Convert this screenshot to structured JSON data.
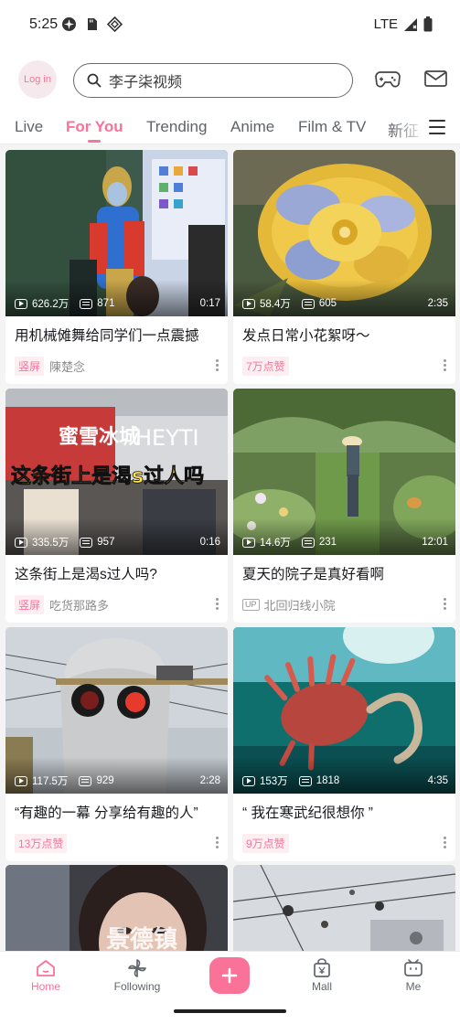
{
  "status": {
    "time": "5:25",
    "network": "LTE"
  },
  "header": {
    "login_label": "Log in",
    "search_text": "李子柒视频"
  },
  "tabs": [
    "Live",
    "For You",
    "Trending",
    "Anime",
    "Film & TV",
    "新征"
  ],
  "cards": [
    {
      "views": "626.2万",
      "danmaku": "871",
      "duration": "0:17",
      "title": "用机械傩舞给同学们一点震撼",
      "tag": "竖屏",
      "author": "陳楚念"
    },
    {
      "views": "58.4万",
      "danmaku": "605",
      "duration": "2:35",
      "title": "发点日常小花絮呀～",
      "tag": "7万点赞",
      "author": ""
    },
    {
      "views": "335.5万",
      "danmaku": "957",
      "duration": "0:16",
      "title": "这条街上是渴s过人吗?",
      "tag": "竖屏",
      "author": "吃货那路多",
      "overlay": "这条街上是渴s过人吗",
      "sign": "蜜雪冰城",
      "sign2": "HEYTI"
    },
    {
      "views": "14.6万",
      "danmaku": "231",
      "duration": "12:01",
      "title": "夏天的院子是真好看啊",
      "tag": "",
      "author": "北回归线小院",
      "badge": "UP"
    },
    {
      "views": "117.5万",
      "danmaku": "929",
      "duration": "2:28",
      "title": "“有趣的一幕 分享给有趣的人”",
      "tag": "13万点赞",
      "author": ""
    },
    {
      "views": "153万",
      "danmaku": "1818",
      "duration": "4:35",
      "title": "“ 我在寒武纪很想你 ”",
      "tag": "9万点赞",
      "author": ""
    },
    {
      "overlay": "景德镇"
    }
  ],
  "nav": {
    "home": "Home",
    "following": "Following",
    "mall": "Mall",
    "me": "Me"
  },
  "colors": {
    "accent": "#fb7299"
  }
}
